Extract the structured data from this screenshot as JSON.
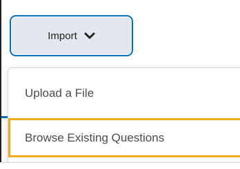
{
  "import_button": {
    "label": "Import",
    "icon": "chevron-down-icon",
    "border_color": "#006fbf",
    "background_color": "#e4e8ee"
  },
  "dropdown": {
    "items": [
      {
        "label": "Upload a File"
      },
      {
        "label": "Browse Existing Questions",
        "highlighted": true
      }
    ],
    "highlight_color": "#f0ab1b"
  }
}
